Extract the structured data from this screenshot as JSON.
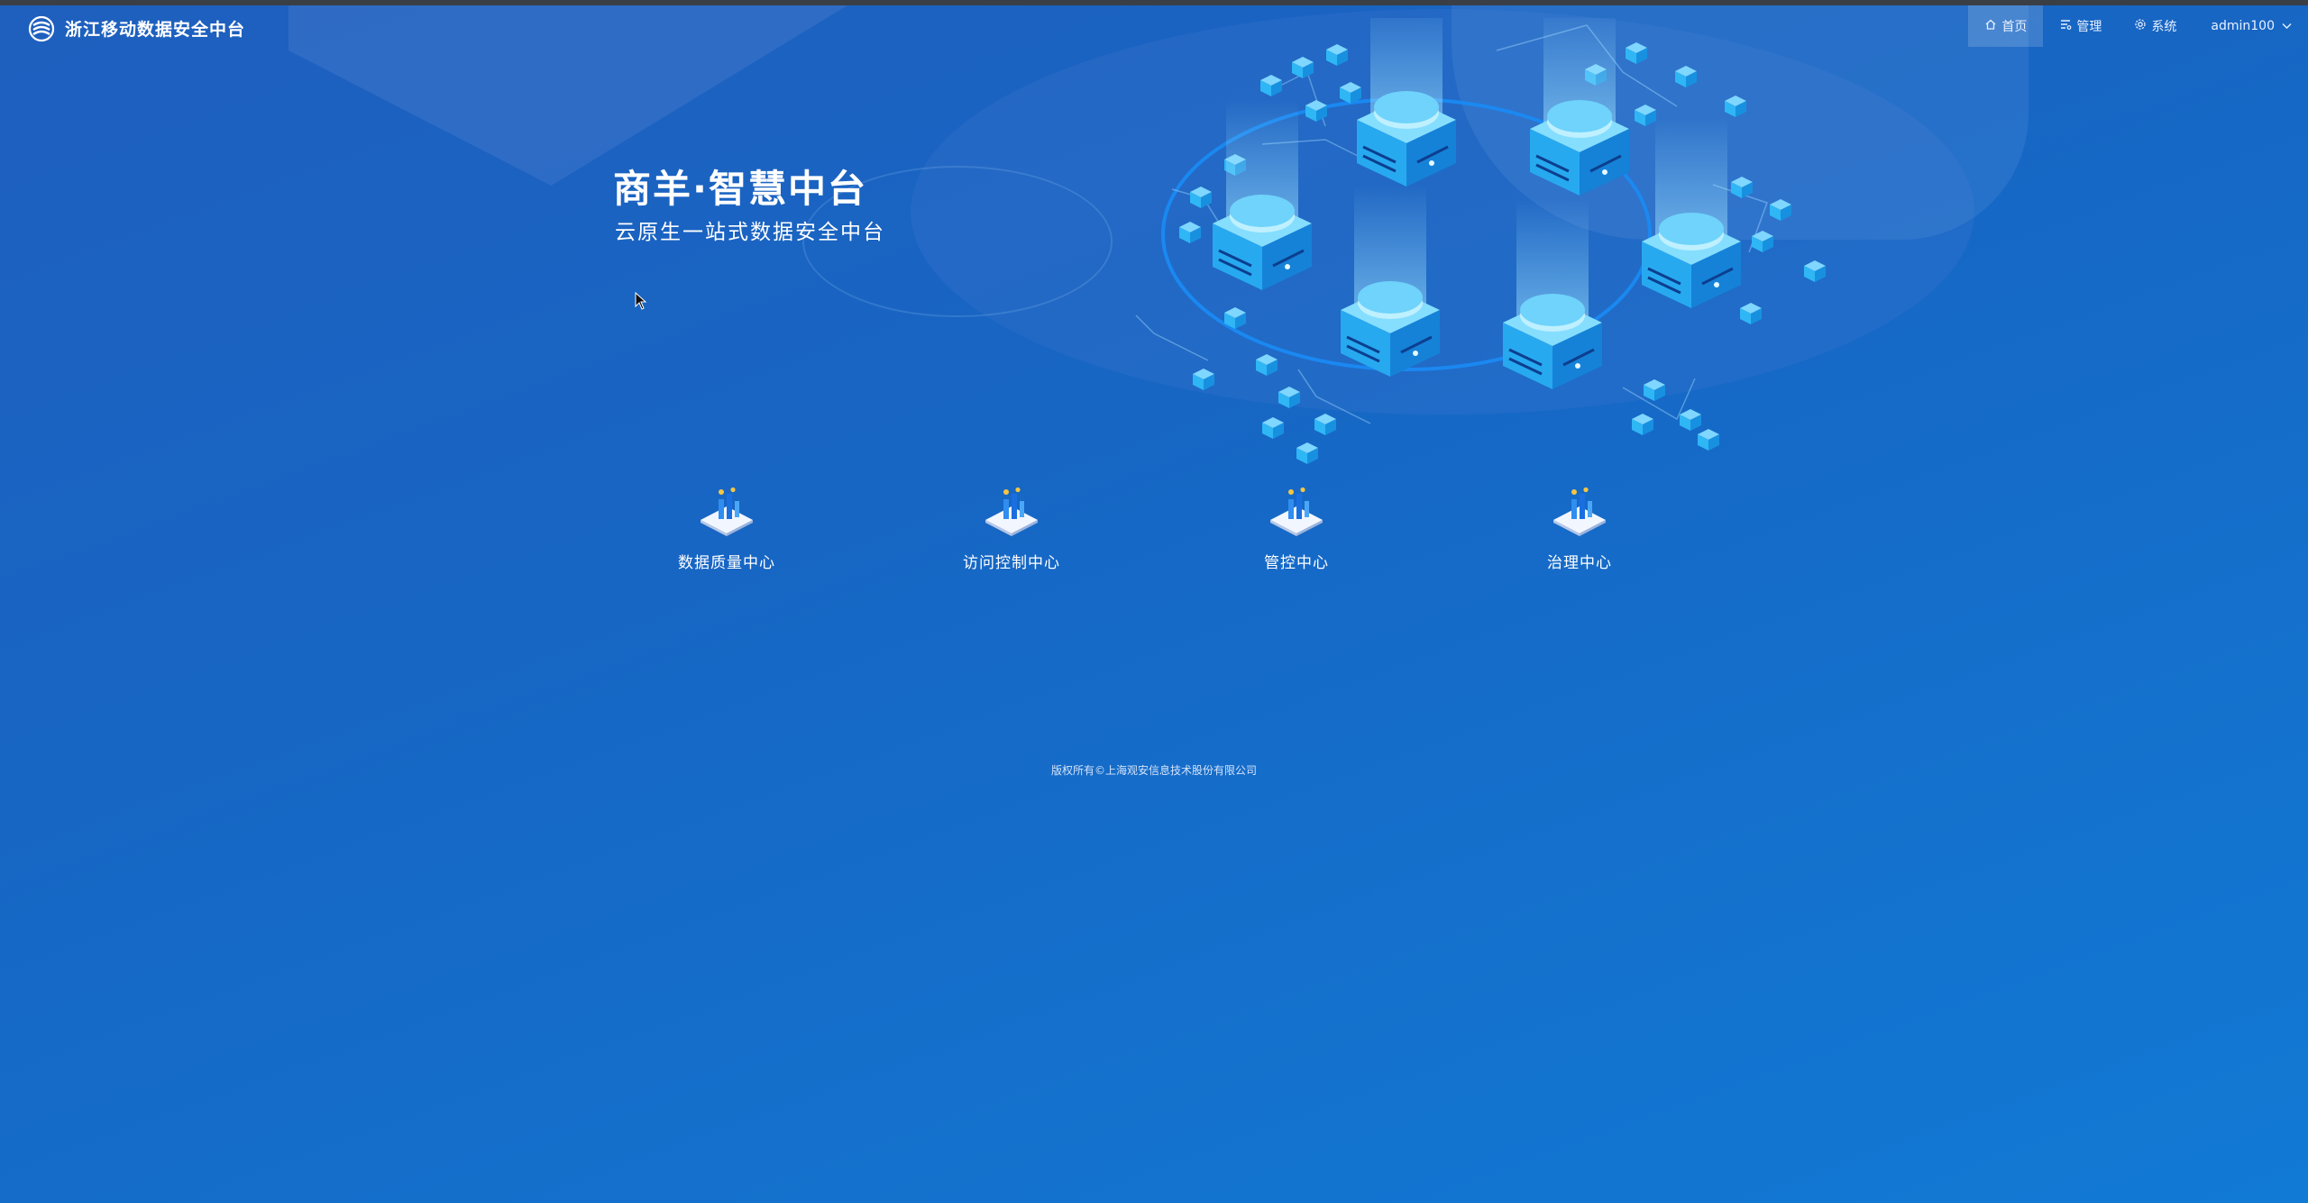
{
  "app": {
    "brand": "浙江移动数据安全中台",
    "logo_icon": "china-mobile-logo-icon"
  },
  "nav": {
    "items": [
      {
        "label": "首页",
        "icon": "home-icon",
        "active": true
      },
      {
        "label": "管理",
        "icon": "manage-icon",
        "active": false
      },
      {
        "label": "系统",
        "icon": "system-icon",
        "active": false
      }
    ],
    "user": {
      "label": "admin100",
      "icon": "chevron-down-icon"
    }
  },
  "hero": {
    "title": "商羊·智慧中台",
    "subtitle": "云原生一站式数据安全中台"
  },
  "modules": [
    {
      "label": "数据质量中心",
      "icon": "module-icon"
    },
    {
      "label": "访问控制中心",
      "icon": "module-icon"
    },
    {
      "label": "管控中心",
      "icon": "module-icon"
    },
    {
      "label": "治理中心",
      "icon": "module-icon"
    }
  ],
  "footer": {
    "copyright": "版权所有©上海观安信息技术股份有限公司"
  },
  "colors": {
    "background": "#1766c4",
    "accent": "#2fb6f5",
    "text": "#ffffff"
  }
}
